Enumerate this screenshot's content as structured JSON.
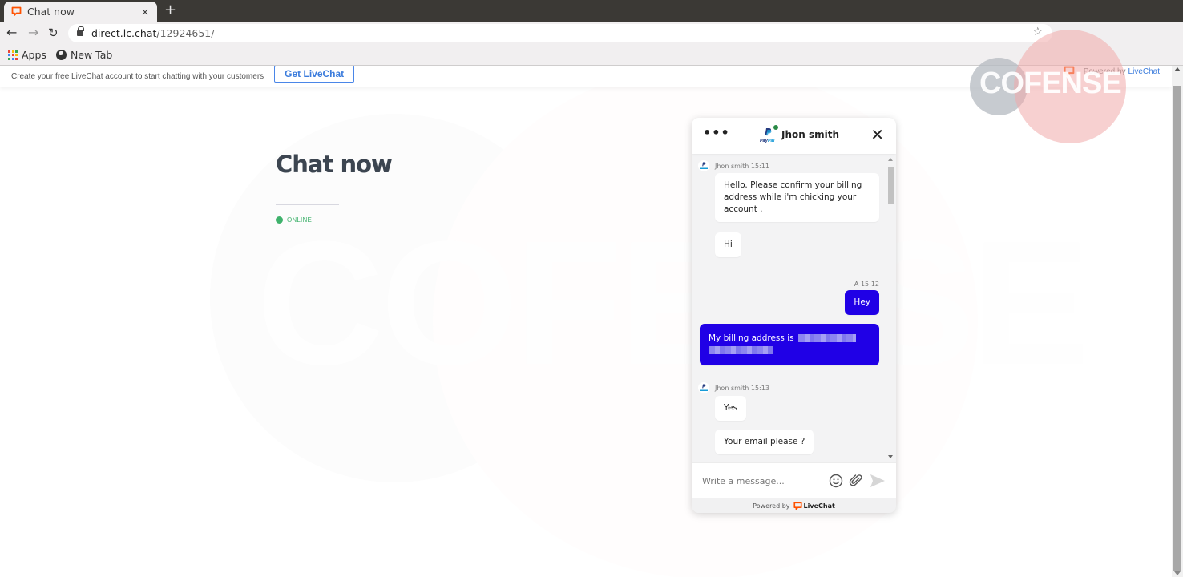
{
  "browser": {
    "tab_title": "Chat now",
    "tab_close": "×",
    "new_tab": "+",
    "url_host": "direct.lc.chat",
    "url_path": "/12924651/",
    "nav_back": "←",
    "nav_forward": "→",
    "nav_reload": "↻",
    "bookmark_star": "☆",
    "bookmarks": [
      {
        "label": "Apps",
        "icon": "apps-grid-icon"
      },
      {
        "label": "New Tab",
        "icon": "globe-icon"
      }
    ]
  },
  "page": {
    "promo_text": "Create your free LiveChat account to start chatting with your customers",
    "promo_button": "Get LiveChat",
    "powered_prefix": "Powered by",
    "powered_link": "LiveChat",
    "heading": "Chat now",
    "status": "ONLINE",
    "watermark_text": "COFENSE",
    "overlay_logo_text": "COFENSE"
  },
  "colors": {
    "accent_blue": "#2000e6",
    "online_green": "#3fb26c",
    "livechat_orange": "#ff5100",
    "link_blue": "#3a7bdc"
  },
  "chat": {
    "menu_label": "•••",
    "agent_name": "Jhon smith",
    "agent_logo_text": "PayPal",
    "close_label": "✕",
    "messages": [
      {
        "meta": "Jhon smith 15:11",
        "direction": "in",
        "text": "Hello. Please confirm your billing address while i'm chicking your account ."
      },
      {
        "direction": "in",
        "text": "Hi"
      },
      {
        "meta": "A 15:12",
        "direction": "out",
        "text": "Hey"
      },
      {
        "direction": "out",
        "text": "My billing address is",
        "redacted": true
      },
      {
        "meta": "Jhon smith 15:13",
        "direction": "in",
        "text": "Yes"
      },
      {
        "direction": "in",
        "text": "Your email please ?"
      }
    ],
    "composer_placeholder": "Write a message...",
    "composer_value": "",
    "footer_prefix": "Powered by",
    "footer_brand": "LiveChat"
  }
}
